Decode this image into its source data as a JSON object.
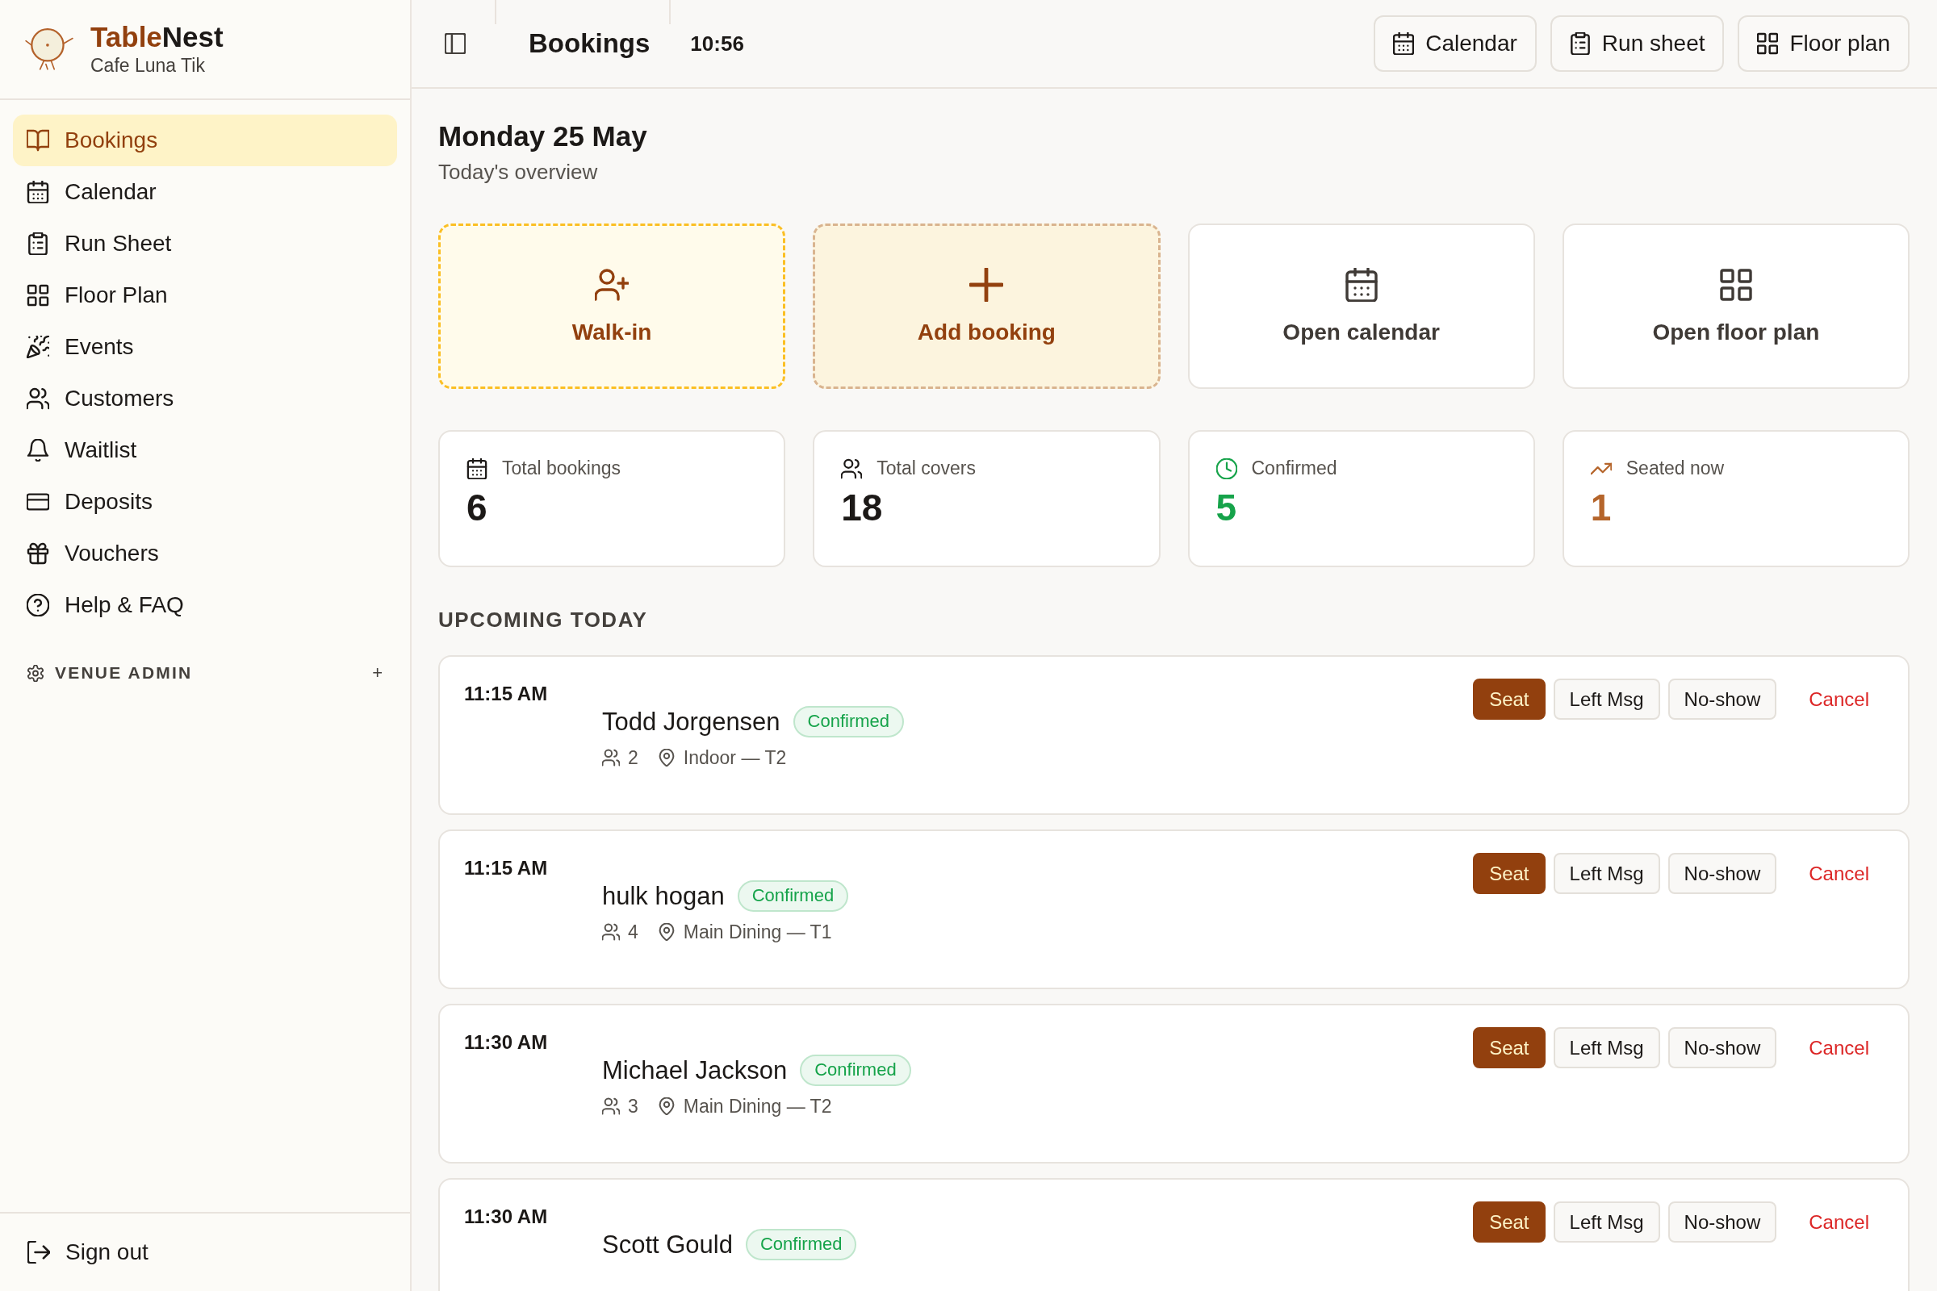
{
  "sidebar": {
    "brand": {
      "accent": "Table",
      "rest": "Nest"
    },
    "venue": "Cafe Luna Tik",
    "nav": [
      {
        "label": "Bookings",
        "selected": true
      },
      {
        "label": "Calendar",
        "selected": false
      },
      {
        "label": "Run Sheet",
        "selected": false
      },
      {
        "label": "Floor Plan",
        "selected": false
      },
      {
        "label": "Events",
        "selected": false
      },
      {
        "label": "Customers",
        "selected": false
      },
      {
        "label": "Waitlist",
        "selected": false
      },
      {
        "label": "Deposits",
        "selected": false
      },
      {
        "label": "Vouchers",
        "selected": false
      },
      {
        "label": "Help & FAQ",
        "selected": false
      }
    ],
    "section": {
      "label": "VENUE ADMIN",
      "toggle": "+"
    },
    "sign_out": "Sign out"
  },
  "header": {
    "title": "Bookings",
    "time": "10:56",
    "buttons": [
      "Calendar",
      "Run sheet",
      "Floor plan"
    ]
  },
  "page": {
    "date": "Monday 25 May",
    "subtitle": "Today's overview"
  },
  "actions": [
    {
      "label": "Walk-in",
      "kind": "walk-in"
    },
    {
      "label": "Add booking",
      "kind": "add"
    },
    {
      "label": "Open calendar",
      "kind": "link"
    },
    {
      "label": "Open floor plan",
      "kind": "link"
    }
  ],
  "stats": [
    {
      "label": "Total bookings",
      "value": "6",
      "color": "#1c1917"
    },
    {
      "label": "Total covers",
      "value": "18",
      "color": "#1c1917"
    },
    {
      "label": "Confirmed",
      "value": "5",
      "color": "#16a34a"
    },
    {
      "label": "Seated now",
      "value": "1",
      "color": "#b5652b"
    }
  ],
  "upcoming": {
    "heading": "UPCOMING TODAY",
    "bookings": [
      {
        "time": "11:15 AM",
        "name": "Todd Jorgensen",
        "status": "Confirmed",
        "covers": "2",
        "location": "Indoor — T2",
        "actions": [
          {
            "label": "Seat",
            "kind": "primary"
          },
          {
            "label": "Left Msg",
            "kind": "outline"
          },
          {
            "label": "No-show",
            "kind": "outline"
          },
          {
            "label": "Cancel",
            "kind": "danger"
          }
        ]
      },
      {
        "time": "11:15 AM",
        "name": "hulk hogan",
        "status": "Confirmed",
        "covers": "4",
        "location": "Main Dining — T1",
        "actions": [
          {
            "label": "Seat",
            "kind": "primary"
          },
          {
            "label": "Left Msg",
            "kind": "outline"
          },
          {
            "label": "No-show",
            "kind": "outline"
          },
          {
            "label": "Cancel",
            "kind": "danger"
          }
        ]
      },
      {
        "time": "11:30 AM",
        "name": "Michael Jackson",
        "status": "Confirmed",
        "covers": "3",
        "location": "Main Dining — T2",
        "actions": [
          {
            "label": "Seat",
            "kind": "primary"
          },
          {
            "label": "Left Msg",
            "kind": "outline"
          },
          {
            "label": "No-show",
            "kind": "outline"
          },
          {
            "label": "Cancel",
            "kind": "danger"
          }
        ]
      },
      {
        "time": "11:30 AM",
        "name": "Scott Gould",
        "status": "Confirmed",
        "actions": [
          {
            "label": "Seat",
            "kind": "primary"
          },
          {
            "label": "Left Msg",
            "kind": "outline"
          },
          {
            "label": "No-show",
            "kind": "outline"
          },
          {
            "label": "Cancel",
            "kind": "danger"
          }
        ]
      }
    ]
  }
}
